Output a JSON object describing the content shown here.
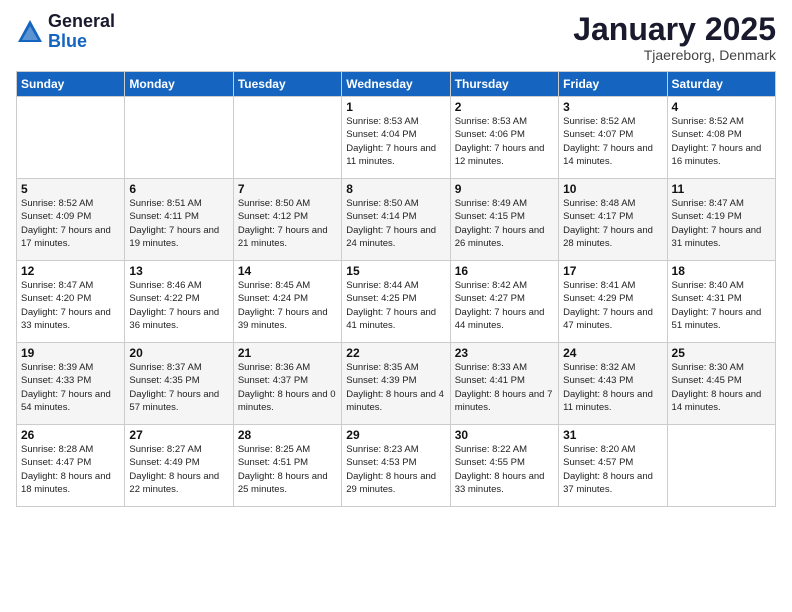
{
  "logo": {
    "general": "General",
    "blue": "Blue"
  },
  "title": "January 2025",
  "location": "Tjaereborg, Denmark",
  "days_header": [
    "Sunday",
    "Monday",
    "Tuesday",
    "Wednesday",
    "Thursday",
    "Friday",
    "Saturday"
  ],
  "weeks": [
    [
      {
        "day": "",
        "info": ""
      },
      {
        "day": "",
        "info": ""
      },
      {
        "day": "",
        "info": ""
      },
      {
        "day": "1",
        "info": "Sunrise: 8:53 AM\nSunset: 4:04 PM\nDaylight: 7 hours\nand 11 minutes."
      },
      {
        "day": "2",
        "info": "Sunrise: 8:53 AM\nSunset: 4:06 PM\nDaylight: 7 hours\nand 12 minutes."
      },
      {
        "day": "3",
        "info": "Sunrise: 8:52 AM\nSunset: 4:07 PM\nDaylight: 7 hours\nand 14 minutes."
      },
      {
        "day": "4",
        "info": "Sunrise: 8:52 AM\nSunset: 4:08 PM\nDaylight: 7 hours\nand 16 minutes."
      }
    ],
    [
      {
        "day": "5",
        "info": "Sunrise: 8:52 AM\nSunset: 4:09 PM\nDaylight: 7 hours\nand 17 minutes."
      },
      {
        "day": "6",
        "info": "Sunrise: 8:51 AM\nSunset: 4:11 PM\nDaylight: 7 hours\nand 19 minutes."
      },
      {
        "day": "7",
        "info": "Sunrise: 8:50 AM\nSunset: 4:12 PM\nDaylight: 7 hours\nand 21 minutes."
      },
      {
        "day": "8",
        "info": "Sunrise: 8:50 AM\nSunset: 4:14 PM\nDaylight: 7 hours\nand 24 minutes."
      },
      {
        "day": "9",
        "info": "Sunrise: 8:49 AM\nSunset: 4:15 PM\nDaylight: 7 hours\nand 26 minutes."
      },
      {
        "day": "10",
        "info": "Sunrise: 8:48 AM\nSunset: 4:17 PM\nDaylight: 7 hours\nand 28 minutes."
      },
      {
        "day": "11",
        "info": "Sunrise: 8:47 AM\nSunset: 4:19 PM\nDaylight: 7 hours\nand 31 minutes."
      }
    ],
    [
      {
        "day": "12",
        "info": "Sunrise: 8:47 AM\nSunset: 4:20 PM\nDaylight: 7 hours\nand 33 minutes."
      },
      {
        "day": "13",
        "info": "Sunrise: 8:46 AM\nSunset: 4:22 PM\nDaylight: 7 hours\nand 36 minutes."
      },
      {
        "day": "14",
        "info": "Sunrise: 8:45 AM\nSunset: 4:24 PM\nDaylight: 7 hours\nand 39 minutes."
      },
      {
        "day": "15",
        "info": "Sunrise: 8:44 AM\nSunset: 4:25 PM\nDaylight: 7 hours\nand 41 minutes."
      },
      {
        "day": "16",
        "info": "Sunrise: 8:42 AM\nSunset: 4:27 PM\nDaylight: 7 hours\nand 44 minutes."
      },
      {
        "day": "17",
        "info": "Sunrise: 8:41 AM\nSunset: 4:29 PM\nDaylight: 7 hours\nand 47 minutes."
      },
      {
        "day": "18",
        "info": "Sunrise: 8:40 AM\nSunset: 4:31 PM\nDaylight: 7 hours\nand 51 minutes."
      }
    ],
    [
      {
        "day": "19",
        "info": "Sunrise: 8:39 AM\nSunset: 4:33 PM\nDaylight: 7 hours\nand 54 minutes."
      },
      {
        "day": "20",
        "info": "Sunrise: 8:37 AM\nSunset: 4:35 PM\nDaylight: 7 hours\nand 57 minutes."
      },
      {
        "day": "21",
        "info": "Sunrise: 8:36 AM\nSunset: 4:37 PM\nDaylight: 8 hours\nand 0 minutes."
      },
      {
        "day": "22",
        "info": "Sunrise: 8:35 AM\nSunset: 4:39 PM\nDaylight: 8 hours\nand 4 minutes."
      },
      {
        "day": "23",
        "info": "Sunrise: 8:33 AM\nSunset: 4:41 PM\nDaylight: 8 hours\nand 7 minutes."
      },
      {
        "day": "24",
        "info": "Sunrise: 8:32 AM\nSunset: 4:43 PM\nDaylight: 8 hours\nand 11 minutes."
      },
      {
        "day": "25",
        "info": "Sunrise: 8:30 AM\nSunset: 4:45 PM\nDaylight: 8 hours\nand 14 minutes."
      }
    ],
    [
      {
        "day": "26",
        "info": "Sunrise: 8:28 AM\nSunset: 4:47 PM\nDaylight: 8 hours\nand 18 minutes."
      },
      {
        "day": "27",
        "info": "Sunrise: 8:27 AM\nSunset: 4:49 PM\nDaylight: 8 hours\nand 22 minutes."
      },
      {
        "day": "28",
        "info": "Sunrise: 8:25 AM\nSunset: 4:51 PM\nDaylight: 8 hours\nand 25 minutes."
      },
      {
        "day": "29",
        "info": "Sunrise: 8:23 AM\nSunset: 4:53 PM\nDaylight: 8 hours\nand 29 minutes."
      },
      {
        "day": "30",
        "info": "Sunrise: 8:22 AM\nSunset: 4:55 PM\nDaylight: 8 hours\nand 33 minutes."
      },
      {
        "day": "31",
        "info": "Sunrise: 8:20 AM\nSunset: 4:57 PM\nDaylight: 8 hours\nand 37 minutes."
      },
      {
        "day": "",
        "info": ""
      }
    ]
  ]
}
